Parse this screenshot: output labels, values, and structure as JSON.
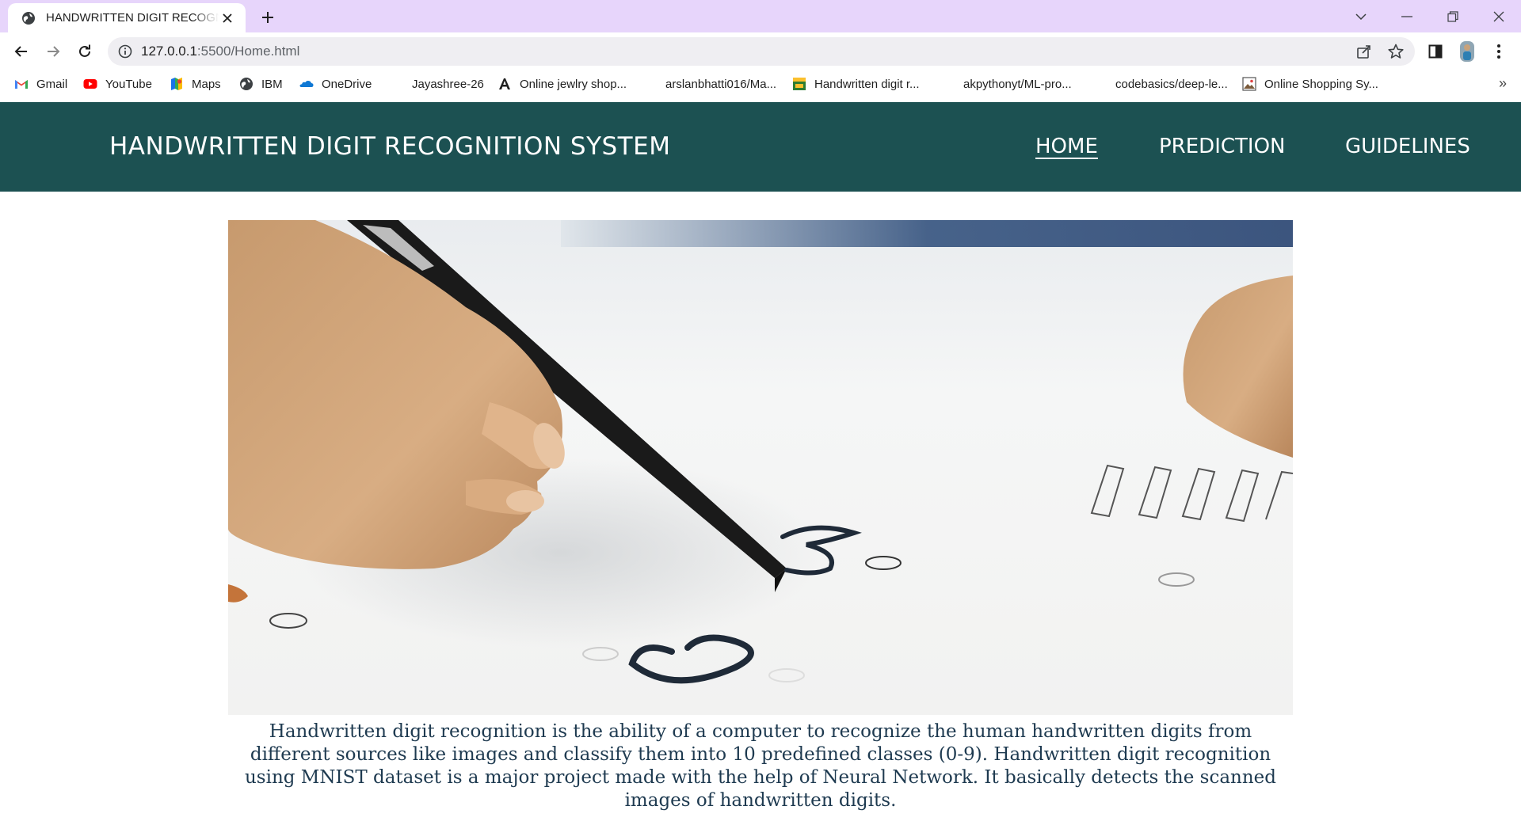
{
  "browser": {
    "tab_title": "HANDWRITTEN DIGIT RECOGNITION SYSTEM",
    "url_host": "127.0.0.1",
    "url_rest": ":5500/Home.html",
    "bookmarks": [
      {
        "label": "Gmail",
        "icon": "gmail-icon"
      },
      {
        "label": "YouTube",
        "icon": "youtube-icon"
      },
      {
        "label": "Maps",
        "icon": "maps-icon"
      },
      {
        "label": "IBM",
        "icon": "globe-icon"
      },
      {
        "label": "OneDrive",
        "icon": "onedrive-icon"
      },
      {
        "label": "Jayashree-26",
        "icon": "github-icon"
      },
      {
        "label": "Online jewlry shop...",
        "icon": "font-a-icon"
      },
      {
        "label": "arslanbhatti016/Ma...",
        "icon": "github-icon"
      },
      {
        "label": "Handwritten digit r...",
        "icon": "site-icon"
      },
      {
        "label": "akpythonyt/ML-pro...",
        "icon": "github-icon"
      },
      {
        "label": "codebasics/deep-le...",
        "icon": "github-icon"
      },
      {
        "label": "Online Shopping Sy...",
        "icon": "image-icon"
      }
    ],
    "more_bookmarks": "»"
  },
  "site": {
    "title": "HANDWRITTEN DIGIT RECOGNITION SYSTEM",
    "nav": {
      "home": "HOME",
      "prediction": "PREDICTION",
      "guidelines": "GUIDELINES"
    },
    "description": "Handwritten digit recognition is the ability of a computer to recognize the human handwritten digits from different sources like images and classify them into 10 predefined classes (0-9). Handwritten digit recognition using MNIST dataset is a major project made with the help of Neural Network. It basically detects the scanned images of handwritten digits."
  },
  "colors": {
    "tabstrip": "#e7d5fb",
    "header": "#1c5152",
    "description_text": "#1e3a50"
  }
}
